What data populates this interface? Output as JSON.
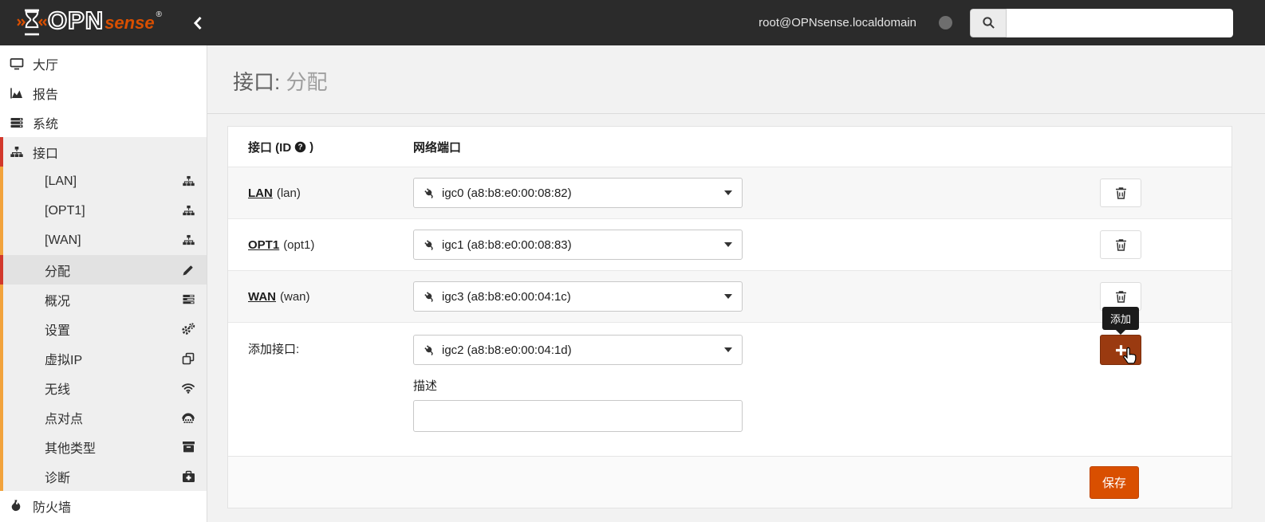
{
  "header": {
    "brand_opn": "OPN",
    "brand_sense": "sense",
    "registered": "®",
    "user": "root@OPNsense.localdomain"
  },
  "sidebar": {
    "items": [
      {
        "label": "大厅"
      },
      {
        "label": "报告"
      },
      {
        "label": "系统"
      },
      {
        "label": "接口"
      },
      {
        "label": "[LAN]"
      },
      {
        "label": "[OPT1]"
      },
      {
        "label": "[WAN]"
      },
      {
        "label": "分配"
      },
      {
        "label": "概况"
      },
      {
        "label": "设置"
      },
      {
        "label": "虚拟IP"
      },
      {
        "label": "无线"
      },
      {
        "label": "点对点"
      },
      {
        "label": "其他类型"
      },
      {
        "label": "诊断"
      },
      {
        "label": "防火墙"
      }
    ]
  },
  "page": {
    "section": "接口:",
    "title": "分配"
  },
  "panel": {
    "columns": {
      "interface_prefix": "接口 (ID",
      "interface_suffix": ")",
      "port": "网络端口"
    },
    "rows": [
      {
        "name": "LAN",
        "code": "(lan)",
        "port": "igc0 (a8:b8:e0:00:08:82)"
      },
      {
        "name": "OPT1",
        "code": "(opt1)",
        "port": "igc1 (a8:b8:e0:00:08:83)"
      },
      {
        "name": "WAN",
        "code": "(wan)",
        "port": "igc3 (a8:b8:e0:00:04:1c)"
      }
    ],
    "add": {
      "label": "添加接口:",
      "port": "igc2 (a8:b8:e0:00:04:1d)",
      "description_label": "描述",
      "description_value": "",
      "tooltip": "添加"
    },
    "save_label": "保存"
  },
  "colors": {
    "accent": "#d94f00",
    "add_button": "#9a3a10",
    "active_strip_red": "#d2382c",
    "section_strip_orange": "#f2a33c",
    "header_bg": "#2b2b2b"
  }
}
